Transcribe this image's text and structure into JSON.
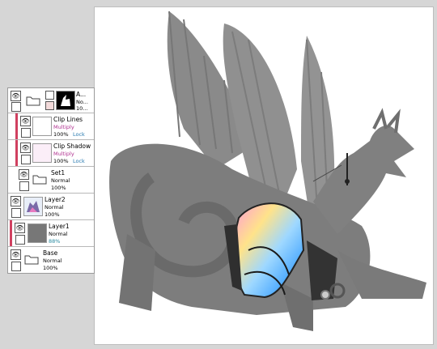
{
  "colors": {
    "background": "#d6d6d6",
    "canvas": "#ffffff",
    "dragon_gray": "#7d7d7d",
    "clip_bar": "#d04060",
    "multiply_text": "#b03090",
    "lock_text": "#2a7ab0"
  },
  "icons": {
    "visibility": "eye-icon",
    "folder": "folder-icon",
    "mask": "mask-icon"
  },
  "layers": [
    {
      "name": "A...",
      "mode": "No...",
      "opacity": "10..."
    },
    {
      "name": "Clip Lines",
      "mode": "Multiply",
      "opacity": "100%",
      "lock": "Lock"
    },
    {
      "name": "Clip Shadow",
      "mode": "Multiply",
      "opacity": "100%",
      "lock": "Lock"
    },
    {
      "name": "Set1",
      "mode": "Normal",
      "opacity": "100%"
    },
    {
      "name": "Layer2",
      "mode": "Normal",
      "opacity": "100%"
    },
    {
      "name": "Layer1",
      "mode": "Normal",
      "opacity": "88%"
    },
    {
      "name": "Base",
      "mode": "Normal",
      "opacity": "100%"
    }
  ]
}
